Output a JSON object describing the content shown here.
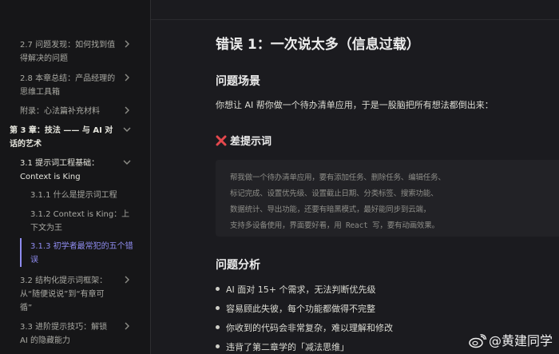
{
  "sidebar": {
    "items": [
      {
        "line1": "2.7 问题发现：如何找到值",
        "line2": "得解决的问题"
      },
      {
        "line1": "2.8 本章总结：产品经理的",
        "line2": "思维工具箱"
      },
      {
        "line1": "附录：心法篇补充材料",
        "line2": ""
      },
      {
        "line1": "第 3 章：技法 —— 与 AI 对",
        "line2": "话的艺术"
      },
      {
        "line1": "3.1 提示词工程基础：",
        "line2": "Context is King"
      },
      {
        "line1": "3.1.1 什么是提示词工程",
        "line2": ""
      },
      {
        "line1": "3.1.2 Context is King：上",
        "line2": "下文为王"
      },
      {
        "line1": "3.1.3 初学者最常犯的五个错",
        "line2": "误"
      },
      {
        "line1": "3.2 结构化提示词框架：",
        "line2": "从“随便说说”到“有章可",
        "line3": "循”"
      },
      {
        "line1": "3.3 进阶提示技巧：解锁",
        "line2": "AI 的隐藏能力"
      }
    ]
  },
  "main": {
    "title": "错误 1：一次说太多（信息过载）",
    "scene_heading": "问题场景",
    "scene_text": "你想让 AI 帮你做一个待办清单应用，于是一股脑把所有想法都倒出来：",
    "bad_prompt_heading": "差提示词",
    "code_lines": [
      "帮我做一个待办清单应用，要有添加任务、删除任务、编辑任务、",
      "标记完成、设置优先级、设置截止日期、分类标签、搜索功能、",
      "数据统计、导出功能，还要有暗黑模式，最好能同步到云端，",
      "支持多设备使用，界面要好看，用 React 写，要有动画效果。"
    ],
    "analysis_heading": "问题分析",
    "bullets": [
      "AI 面对 15+ 个需求，无法判断优先级",
      "容易顾此失彼，每个功能都做得不完整",
      "你收到的代码会非常复杂，难以理解和修改",
      "违背了第二章学的「减法思维」"
    ]
  },
  "watermark": {
    "text": "@黄建同学"
  },
  "colors": {
    "accent": "#8f8cf0",
    "background": "#1b1b1f",
    "sidebar": "#161618",
    "error_icon": "#e5484d"
  }
}
